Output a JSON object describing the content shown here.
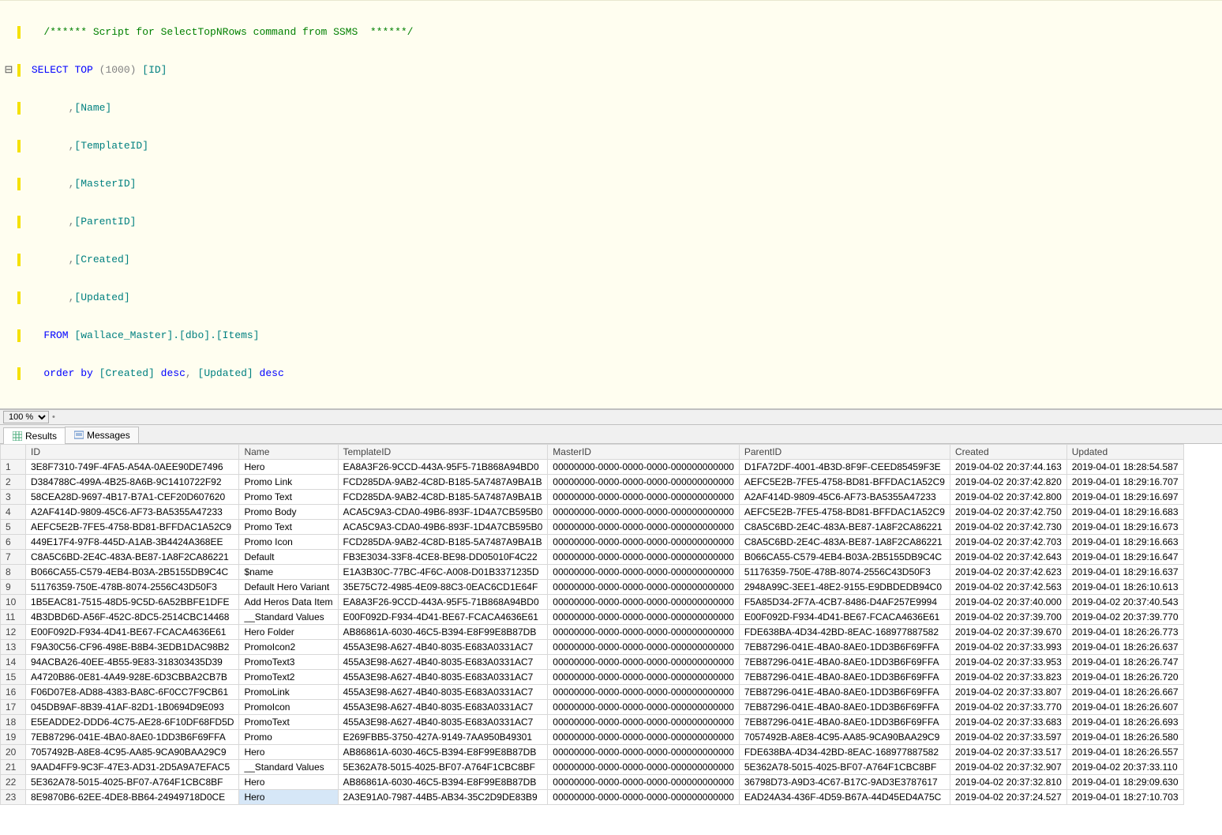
{
  "zoom": {
    "value": "100 %"
  },
  "sql": {
    "comment": "/****** Script for SelectTopNRows command from SSMS  ******/",
    "select": "SELECT",
    "top": "TOP",
    "topN": "(1000)",
    "cols": [
      "[ID]",
      "[Name]",
      "[TemplateID]",
      "[MasterID]",
      "[ParentID]",
      "[Created]",
      "[Updated]"
    ],
    "from": "FROM",
    "fromTable": "[wallace_Master].[dbo].[Items]",
    "order": "order by",
    "orderExpr_created": "[Created]",
    "orderExpr_updated": "[Updated]",
    "desc": "desc"
  },
  "tabs": {
    "results": "Results",
    "messages": "Messages"
  },
  "headers": {
    "rownum": "",
    "id": "ID",
    "name": "Name",
    "template": "TemplateID",
    "master": "MasterID",
    "parent": "ParentID",
    "created": "Created",
    "updated": "Updated"
  },
  "rows": [
    {
      "n": "1",
      "id": "3E8F7310-749F-4FA5-A54A-0AEE90DE7496",
      "name": "Hero",
      "tpl": "EA8A3F26-9CCD-443A-95F5-71B868A94BD0",
      "mst": "00000000-0000-0000-0000-000000000000",
      "par": "D1FA72DF-4001-4B3D-8F9F-CEED85459F3E",
      "cre": "2019-04-02 20:37:44.163",
      "upd": "2019-04-01 18:28:54.587"
    },
    {
      "n": "2",
      "id": "D384788C-499A-4B25-8A6B-9C1410722F92",
      "name": "Promo Link",
      "tpl": "FCD285DA-9AB2-4C8D-B185-5A7487A9BA1B",
      "mst": "00000000-0000-0000-0000-000000000000",
      "par": "AEFC5E2B-7FE5-4758-BD81-BFFDAC1A52C9",
      "cre": "2019-04-02 20:37:42.820",
      "upd": "2019-04-01 18:29:16.707"
    },
    {
      "n": "3",
      "id": "58CEA28D-9697-4B17-B7A1-CEF20D607620",
      "name": "Promo Text",
      "tpl": "FCD285DA-9AB2-4C8D-B185-5A7487A9BA1B",
      "mst": "00000000-0000-0000-0000-000000000000",
      "par": "A2AF414D-9809-45C6-AF73-BA5355A47233",
      "cre": "2019-04-02 20:37:42.800",
      "upd": "2019-04-01 18:29:16.697"
    },
    {
      "n": "4",
      "id": "A2AF414D-9809-45C6-AF73-BA5355A47233",
      "name": "Promo Body",
      "tpl": "ACA5C9A3-CDA0-49B6-893F-1D4A7CB595B0",
      "mst": "00000000-0000-0000-0000-000000000000",
      "par": "AEFC5E2B-7FE5-4758-BD81-BFFDAC1A52C9",
      "cre": "2019-04-02 20:37:42.750",
      "upd": "2019-04-01 18:29:16.683"
    },
    {
      "n": "5",
      "id": "AEFC5E2B-7FE5-4758-BD81-BFFDAC1A52C9",
      "name": "Promo Text",
      "tpl": "ACA5C9A3-CDA0-49B6-893F-1D4A7CB595B0",
      "mst": "00000000-0000-0000-0000-000000000000",
      "par": "C8A5C6BD-2E4C-483A-BE87-1A8F2CA86221",
      "cre": "2019-04-02 20:37:42.730",
      "upd": "2019-04-01 18:29:16.673"
    },
    {
      "n": "6",
      "id": "449E17F4-97F8-445D-A1AB-3B4424A368EE",
      "name": "Promo Icon",
      "tpl": "FCD285DA-9AB2-4C8D-B185-5A7487A9BA1B",
      "mst": "00000000-0000-0000-0000-000000000000",
      "par": "C8A5C6BD-2E4C-483A-BE87-1A8F2CA86221",
      "cre": "2019-04-02 20:37:42.703",
      "upd": "2019-04-01 18:29:16.663"
    },
    {
      "n": "7",
      "id": "C8A5C6BD-2E4C-483A-BE87-1A8F2CA86221",
      "name": "Default",
      "tpl": "FB3E3034-33F8-4CE8-BE98-DD05010F4C22",
      "mst": "00000000-0000-0000-0000-000000000000",
      "par": "B066CA55-C579-4EB4-B03A-2B5155DB9C4C",
      "cre": "2019-04-02 20:37:42.643",
      "upd": "2019-04-01 18:29:16.647"
    },
    {
      "n": "8",
      "id": "B066CA55-C579-4EB4-B03A-2B5155DB9C4C",
      "name": "$name",
      "tpl": "E1A3B30C-77BC-4F6C-A008-D01B3371235D",
      "mst": "00000000-0000-0000-0000-000000000000",
      "par": "51176359-750E-478B-8074-2556C43D50F3",
      "cre": "2019-04-02 20:37:42.623",
      "upd": "2019-04-01 18:29:16.637"
    },
    {
      "n": "9",
      "id": "51176359-750E-478B-8074-2556C43D50F3",
      "name": "Default Hero Variant",
      "tpl": "35E75C72-4985-4E09-88C3-0EAC6CD1E64F",
      "mst": "00000000-0000-0000-0000-000000000000",
      "par": "2948A99C-3EE1-48E2-9155-E9DBDEDB94C0",
      "cre": "2019-04-02 20:37:42.563",
      "upd": "2019-04-01 18:26:10.613"
    },
    {
      "n": "10",
      "id": "1B5EAC81-7515-48D5-9C5D-6A52BBFE1DFE",
      "name": "Add Heros Data Item",
      "tpl": "EA8A3F26-9CCD-443A-95F5-71B868A94BD0",
      "mst": "00000000-0000-0000-0000-000000000000",
      "par": "F5A85D34-2F7A-4CB7-8486-D4AF257E9994",
      "cre": "2019-04-02 20:37:40.000",
      "upd": "2019-04-02 20:37:40.543"
    },
    {
      "n": "11",
      "id": "4B3DBD6D-A56F-452C-8DC5-2514CBC14468",
      "name": "__Standard Values",
      "tpl": "E00F092D-F934-4D41-BE67-FCACA4636E61",
      "mst": "00000000-0000-0000-0000-000000000000",
      "par": "E00F092D-F934-4D41-BE67-FCACA4636E61",
      "cre": "2019-04-02 20:37:39.700",
      "upd": "2019-04-02 20:37:39.770"
    },
    {
      "n": "12",
      "id": "E00F092D-F934-4D41-BE67-FCACA4636E61",
      "name": "Hero Folder",
      "tpl": "AB86861A-6030-46C5-B394-E8F99E8B87DB",
      "mst": "00000000-0000-0000-0000-000000000000",
      "par": "FDE638BA-4D34-42BD-8EAC-168977887582",
      "cre": "2019-04-02 20:37:39.670",
      "upd": "2019-04-01 18:26:26.773"
    },
    {
      "n": "13",
      "id": "F9A30C56-CF96-498E-B8B4-3EDB1DAC98B2",
      "name": "PromoIcon2",
      "tpl": "455A3E98-A627-4B40-8035-E683A0331AC7",
      "mst": "00000000-0000-0000-0000-000000000000",
      "par": "7EB87296-041E-4BA0-8AE0-1DD3B6F69FFA",
      "cre": "2019-04-02 20:37:33.993",
      "upd": "2019-04-01 18:26:26.637"
    },
    {
      "n": "14",
      "id": "94ACBA26-40EE-4B55-9E83-318303435D39",
      "name": "PromoText3",
      "tpl": "455A3E98-A627-4B40-8035-E683A0331AC7",
      "mst": "00000000-0000-0000-0000-000000000000",
      "par": "7EB87296-041E-4BA0-8AE0-1DD3B6F69FFA",
      "cre": "2019-04-02 20:37:33.953",
      "upd": "2019-04-01 18:26:26.747"
    },
    {
      "n": "15",
      "id": "A4720B86-0E81-4A49-928E-6D3CBBA2CB7B",
      "name": "PromoText2",
      "tpl": "455A3E98-A627-4B40-8035-E683A0331AC7",
      "mst": "00000000-0000-0000-0000-000000000000",
      "par": "7EB87296-041E-4BA0-8AE0-1DD3B6F69FFA",
      "cre": "2019-04-02 20:37:33.823",
      "upd": "2019-04-01 18:26:26.720"
    },
    {
      "n": "16",
      "id": "F06D07E8-AD88-4383-BA8C-6F0CC7F9CB61",
      "name": "PromoLink",
      "tpl": "455A3E98-A627-4B40-8035-E683A0331AC7",
      "mst": "00000000-0000-0000-0000-000000000000",
      "par": "7EB87296-041E-4BA0-8AE0-1DD3B6F69FFA",
      "cre": "2019-04-02 20:37:33.807",
      "upd": "2019-04-01 18:26:26.667"
    },
    {
      "n": "17",
      "id": "045DB9AF-8B39-41AF-82D1-1B0694D9E093",
      "name": "PromoIcon",
      "tpl": "455A3E98-A627-4B40-8035-E683A0331AC7",
      "mst": "00000000-0000-0000-0000-000000000000",
      "par": "7EB87296-041E-4BA0-8AE0-1DD3B6F69FFA",
      "cre": "2019-04-02 20:37:33.770",
      "upd": "2019-04-01 18:26:26.607"
    },
    {
      "n": "18",
      "id": "E5EADDE2-DDD6-4C75-AE28-6F10DF68FD5D",
      "name": "PromoText",
      "tpl": "455A3E98-A627-4B40-8035-E683A0331AC7",
      "mst": "00000000-0000-0000-0000-000000000000",
      "par": "7EB87296-041E-4BA0-8AE0-1DD3B6F69FFA",
      "cre": "2019-04-02 20:37:33.683",
      "upd": "2019-04-01 18:26:26.693"
    },
    {
      "n": "19",
      "id": "7EB87296-041E-4BA0-8AE0-1DD3B6F69FFA",
      "name": "Promo",
      "tpl": "E269FBB5-3750-427A-9149-7AA950B49301",
      "mst": "00000000-0000-0000-0000-000000000000",
      "par": "7057492B-A8E8-4C95-AA85-9CA90BAA29C9",
      "cre": "2019-04-02 20:37:33.597",
      "upd": "2019-04-01 18:26:26.580"
    },
    {
      "n": "20",
      "id": "7057492B-A8E8-4C95-AA85-9CA90BAA29C9",
      "name": "Hero",
      "tpl": "AB86861A-6030-46C5-B394-E8F99E8B87DB",
      "mst": "00000000-0000-0000-0000-000000000000",
      "par": "FDE638BA-4D34-42BD-8EAC-168977887582",
      "cre": "2019-04-02 20:37:33.517",
      "upd": "2019-04-01 18:26:26.557"
    },
    {
      "n": "21",
      "id": "9AAD4FF9-9C3F-47E3-AD31-2D5A9A7EFAC5",
      "name": "__Standard Values",
      "tpl": "5E362A78-5015-4025-BF07-A764F1CBC8BF",
      "mst": "00000000-0000-0000-0000-000000000000",
      "par": "5E362A78-5015-4025-BF07-A764F1CBC8BF",
      "cre": "2019-04-02 20:37:32.907",
      "upd": "2019-04-02 20:37:33.110"
    },
    {
      "n": "22",
      "id": "5E362A78-5015-4025-BF07-A764F1CBC8BF",
      "name": "Hero",
      "tpl": "AB86861A-6030-46C5-B394-E8F99E8B87DB",
      "mst": "00000000-0000-0000-0000-000000000000",
      "par": "36798D73-A9D3-4C67-B17C-9AD3E3787617",
      "cre": "2019-04-02 20:37:32.810",
      "upd": "2019-04-01 18:29:09.630"
    },
    {
      "n": "23",
      "id": "8E9870B6-62EE-4DE8-BB64-24949718D0CE",
      "name": "Hero",
      "tpl": "2A3E91A0-7987-44B5-AB34-35C2D9DE83B9",
      "mst": "00000000-0000-0000-0000-000000000000",
      "par": "EAD24A34-436F-4D59-B67A-44D45ED4A75C",
      "cre": "2019-04-02 20:37:24.527",
      "upd": "2019-04-01 18:27:10.703",
      "sel": true
    }
  ]
}
